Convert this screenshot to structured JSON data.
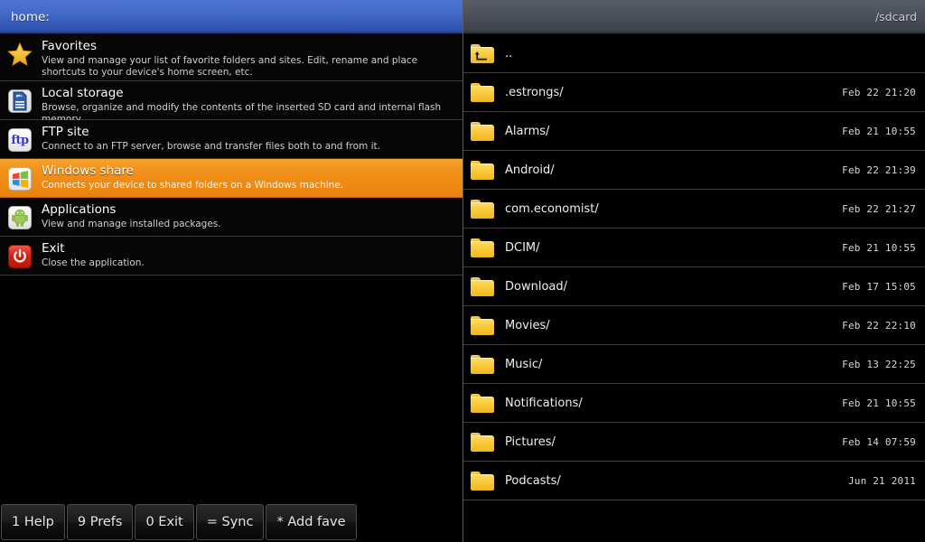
{
  "left": {
    "header_title": "home:",
    "items": [
      {
        "icon": "star-icon",
        "title": "Favorites",
        "desc": "View and manage your list of favorite folders and sites. Edit, rename and place shortcuts to your device's home screen, etc.",
        "selected": false
      },
      {
        "icon": "sd-card-icon",
        "title": "Local storage",
        "desc": "Browse, organize and modify the contents of the inserted SD card and internal flash memory.",
        "selected": false
      },
      {
        "icon": "ftp-icon",
        "title": "FTP site",
        "desc": "Connect to an FTP server, browse and transfer files both to and from it.",
        "selected": false
      },
      {
        "icon": "windows-logo-icon",
        "title": "Windows share",
        "desc": "Connects your device to shared folders on a Windows machine.",
        "selected": true
      },
      {
        "icon": "android-robot-icon",
        "title": "Applications",
        "desc": "View and manage installed packages.",
        "selected": false
      },
      {
        "icon": "power-icon",
        "title": "Exit",
        "desc": "Close the application.",
        "selected": false
      }
    ]
  },
  "right": {
    "header_path": "/sdcard",
    "files": [
      {
        "icon": "folder-up-icon",
        "name": "..",
        "date": ""
      },
      {
        "icon": "folder-icon",
        "name": ".estrongs/",
        "date": "Feb 22 21:20"
      },
      {
        "icon": "folder-icon",
        "name": "Alarms/",
        "date": "Feb 21 10:55"
      },
      {
        "icon": "folder-icon",
        "name": "Android/",
        "date": "Feb 22 21:39"
      },
      {
        "icon": "folder-icon",
        "name": "com.economist/",
        "date": "Feb 22 21:27"
      },
      {
        "icon": "folder-icon",
        "name": "DCIM/",
        "date": "Feb 21 10:55"
      },
      {
        "icon": "folder-icon",
        "name": "Download/",
        "date": "Feb 17 15:05"
      },
      {
        "icon": "folder-icon",
        "name": "Movies/",
        "date": "Feb 22 22:10"
      },
      {
        "icon": "folder-icon",
        "name": "Music/",
        "date": "Feb 13 22:25"
      },
      {
        "icon": "folder-icon",
        "name": "Notifications/",
        "date": "Feb 21 10:55"
      },
      {
        "icon": "folder-icon",
        "name": "Pictures/",
        "date": "Feb 14 07:59"
      },
      {
        "icon": "folder-icon",
        "name": "Podcasts/",
        "date": "Jun 21 2011"
      }
    ]
  },
  "toolbar": {
    "buttons": [
      {
        "label": "1 Help"
      },
      {
        "label": "9 Prefs"
      },
      {
        "label": "0 Exit"
      },
      {
        "label": "= Sync"
      },
      {
        "label": "* Add fave"
      }
    ]
  },
  "colors": {
    "header_blue": "#416ac9",
    "header_gray": "#4c505a",
    "selected_orange": "#f0901a",
    "folder_yellow": "#f9cb3d",
    "background": "#000000",
    "divider": "#3e3e3e"
  }
}
